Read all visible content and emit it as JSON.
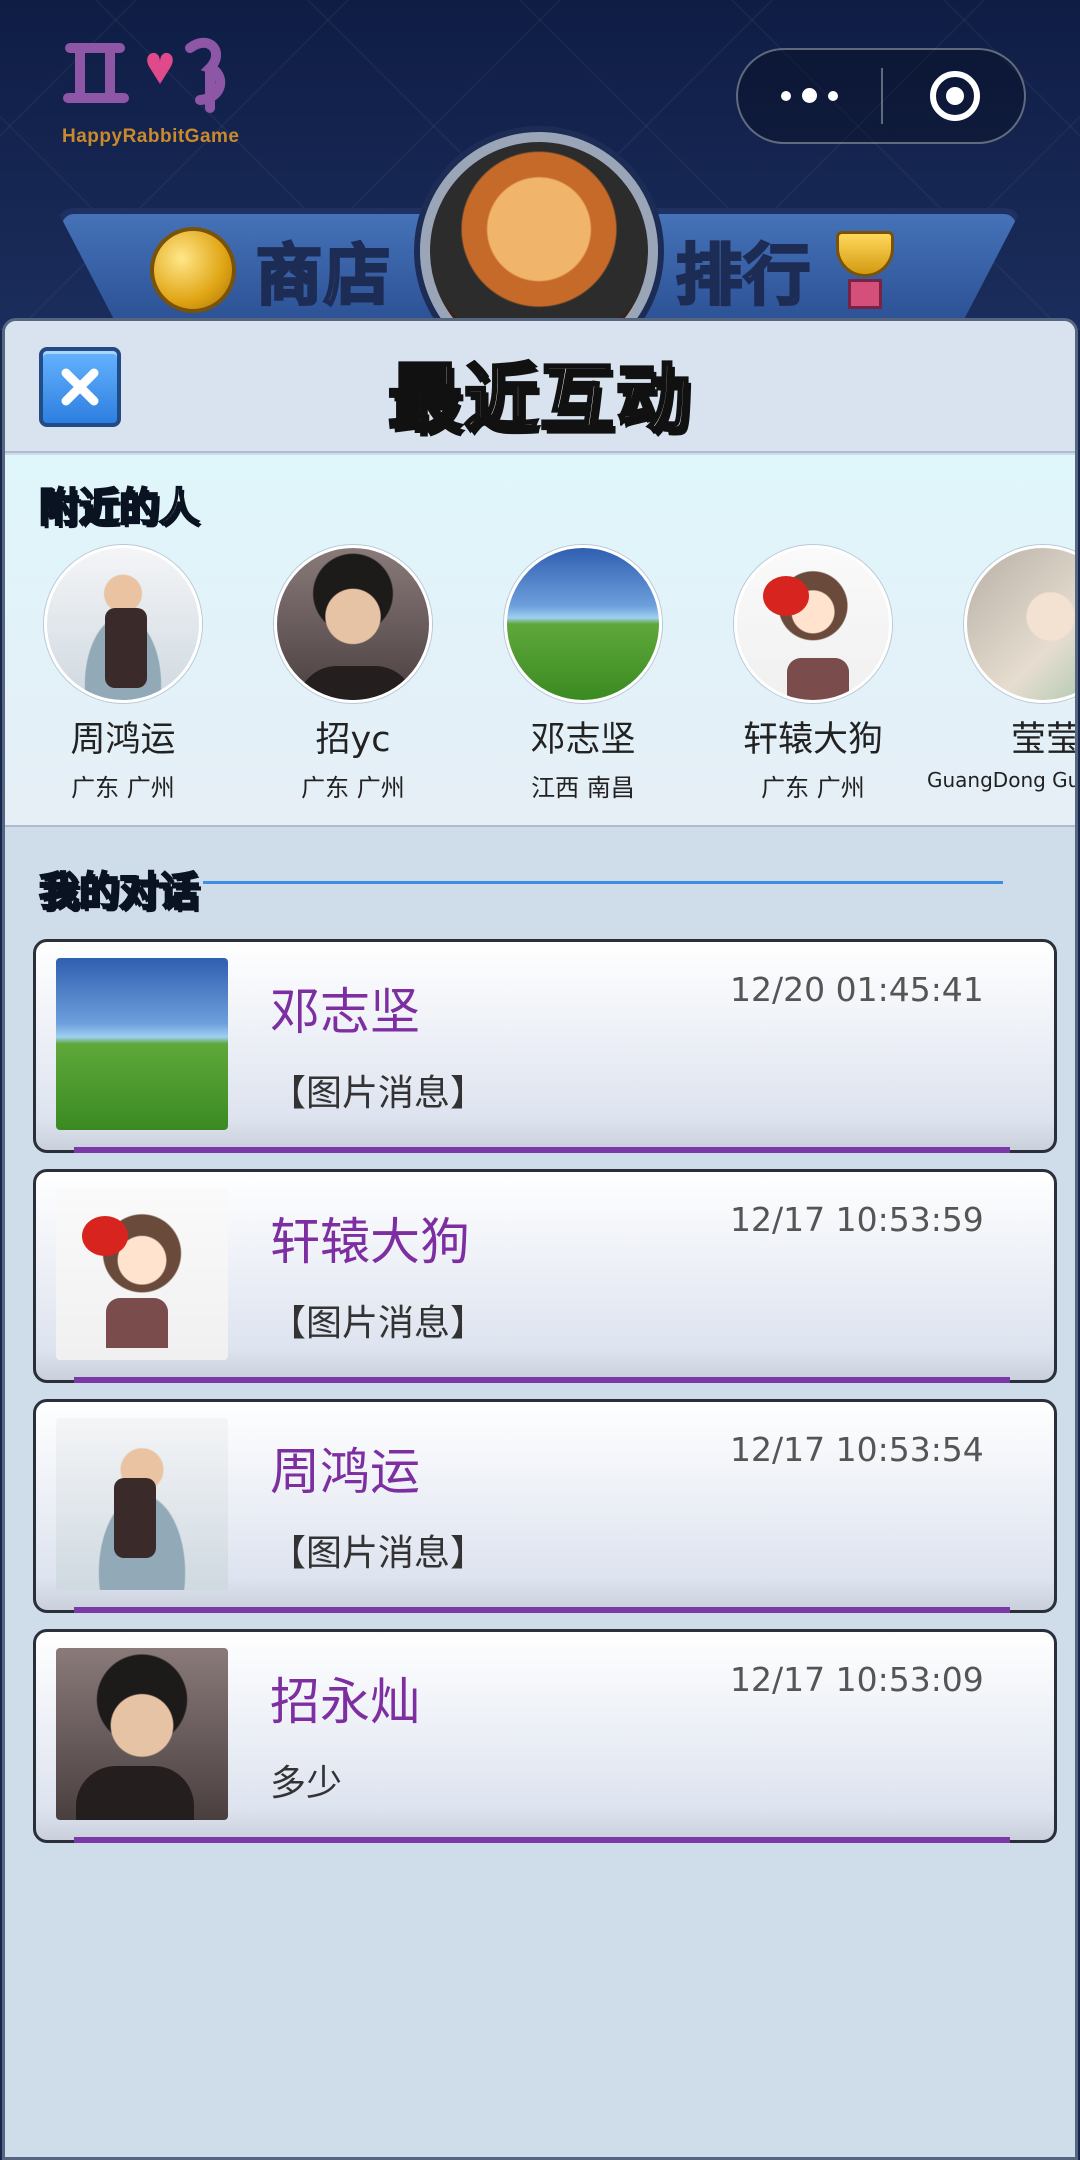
{
  "app": {
    "logo_text": "HappyRabbitGame",
    "capsule": {
      "more_icon": "more-dots-icon",
      "close_icon": "target-close-icon"
    }
  },
  "game_banner": {
    "shop_label": "商店",
    "rank_label": "排行"
  },
  "panel": {
    "title": "最近互动",
    "close_icon": "close-x-icon"
  },
  "nearby": {
    "title": "附近的人",
    "people": [
      {
        "name": "周鸿运",
        "location": "广东 广州"
      },
      {
        "name": "招yc",
        "location": "广东 广州"
      },
      {
        "name": "邓志坚",
        "location": "江西 南昌"
      },
      {
        "name": "轩辕大狗",
        "location": "广东 广州"
      },
      {
        "name": "莹莹",
        "location": "GuangDong Gua"
      }
    ]
  },
  "chats": {
    "title": "我的对话",
    "items": [
      {
        "name": "邓志坚",
        "time": "12/20 01:45:41",
        "message": "【图片消息】"
      },
      {
        "name": "轩辕大狗",
        "time": "12/17 10:53:59",
        "message": "【图片消息】"
      },
      {
        "name": "周鸿运",
        "time": "12/17 10:53:54",
        "message": "【图片消息】"
      },
      {
        "name": "招永灿",
        "time": "12/17 10:53:09",
        "message": "多少"
      }
    ]
  },
  "colors": {
    "accent_purple": "#7d2fa2",
    "close_blue": "#2d7fe0",
    "panel_bg": "#cfdcea",
    "divider_blue": "#3e8ee6"
  }
}
